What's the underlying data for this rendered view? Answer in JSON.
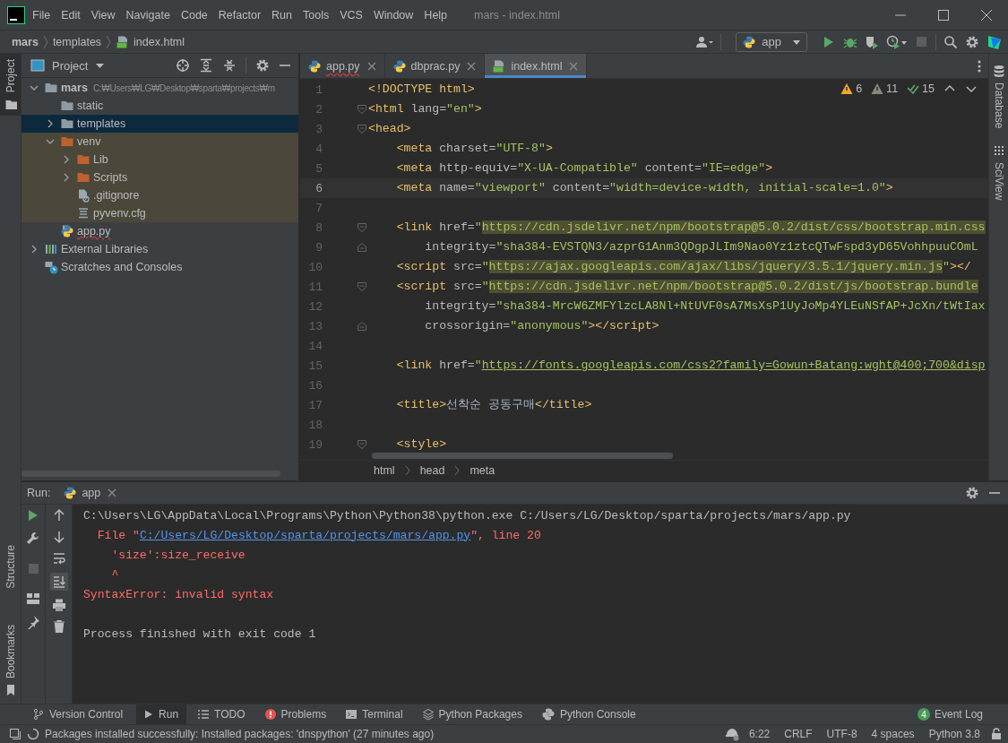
{
  "window": {
    "title": "mars - index.html",
    "menu": [
      "File",
      "Edit",
      "View",
      "Navigate",
      "Code",
      "Refactor",
      "Run",
      "Tools",
      "VCS",
      "Window",
      "Help"
    ]
  },
  "navigation": {
    "breadcrumb": [
      "mars",
      "templates",
      "index.html"
    ],
    "run_configuration": "app"
  },
  "left_stripe": [
    {
      "label": "Project",
      "selected": true
    },
    {
      "label": "Structure",
      "selected": false
    },
    {
      "label": "Bookmarks",
      "selected": false
    }
  ],
  "right_stripe": [
    {
      "label": "Database"
    },
    {
      "label": "SciView"
    }
  ],
  "project": {
    "title": "Project",
    "tree": [
      {
        "label": "mars",
        "path": "C:₩Users₩LG₩Desktop₩sparta₩projects₩m",
        "kind": "folder",
        "expanded": true,
        "selected": false,
        "children": [
          {
            "label": "static",
            "kind": "folder",
            "selected": false
          },
          {
            "label": "templates",
            "kind": "folder",
            "expanded": false,
            "selected": true
          },
          {
            "label": "venv",
            "kind": "excluded-folder",
            "expanded": true,
            "selected": false,
            "children": [
              {
                "label": "Lib",
                "kind": "excluded-folder",
                "expanded": false,
                "selected": false
              },
              {
                "label": "Scripts",
                "kind": "excluded-folder",
                "expanded": false,
                "selected": false
              },
              {
                "label": ".gitignore",
                "kind": "ignore-file",
                "selected": false
              },
              {
                "label": "pyvenv.cfg",
                "kind": "config-file",
                "selected": false
              }
            ]
          },
          {
            "label": "app.py",
            "kind": "python-file",
            "selected": false
          }
        ]
      },
      {
        "label": "External Libraries",
        "kind": "libraries",
        "expanded": false,
        "selected": false
      },
      {
        "label": "Scratches and Consoles",
        "kind": "scratches",
        "selected": false
      }
    ]
  },
  "editor": {
    "tabs": [
      {
        "label": "app.py",
        "kind": "python",
        "error": true,
        "selected": false
      },
      {
        "label": "dbprac.py",
        "kind": "python",
        "error": false,
        "selected": false
      },
      {
        "label": "index.html",
        "kind": "html",
        "error": false,
        "selected": true
      }
    ],
    "inspections": [
      {
        "kind": "warning",
        "count": "6"
      },
      {
        "kind": "weak-warning",
        "count": "11"
      },
      {
        "kind": "typo",
        "count": "15"
      }
    ],
    "lines": [
      {
        "number": "1",
        "kind": "plain",
        "current": false,
        "tokens": [
          {
            "kind": "tag",
            "text": "<!DOCTYPE html>"
          }
        ]
      },
      {
        "number": "2",
        "kind": "fold-start",
        "current": false,
        "tokens": [
          {
            "kind": "tag",
            "text": "<html"
          },
          {
            "kind": "attr",
            "text": " lang="
          },
          {
            "kind": "value",
            "text": "\"en\""
          },
          {
            "kind": "tag",
            "text": ">"
          }
        ]
      },
      {
        "number": "3",
        "kind": "fold-start",
        "current": false,
        "tokens": [
          {
            "kind": "tag",
            "text": "<head>"
          }
        ]
      },
      {
        "number": "4",
        "kind": "plain",
        "current": false,
        "tokens": [
          {
            "kind": "tag",
            "text": "    <meta"
          },
          {
            "kind": "attr",
            "text": " charset="
          },
          {
            "kind": "value",
            "text": "\"UTF-8\""
          },
          {
            "kind": "tag",
            "text": ">"
          }
        ]
      },
      {
        "number": "5",
        "kind": "plain",
        "current": false,
        "tokens": [
          {
            "kind": "tag",
            "text": "    <meta"
          },
          {
            "kind": "attr",
            "text": " http-equiv="
          },
          {
            "kind": "value",
            "text": "\"X-UA-Compatible\""
          },
          {
            "kind": "attr",
            "text": " content="
          },
          {
            "kind": "value",
            "text": "\"IE=edge\""
          },
          {
            "kind": "tag",
            "text": ">"
          }
        ]
      },
      {
        "number": "6",
        "kind": "plain",
        "current": true,
        "tokens": [
          {
            "kind": "tag",
            "text": "    <meta"
          },
          {
            "kind": "attr",
            "text": " name="
          },
          {
            "kind": "value",
            "text": "\"viewport\""
          },
          {
            "kind": "attr",
            "text": " content="
          },
          {
            "kind": "value",
            "text": "\"width=device-width, initial-scale=1.0\""
          },
          {
            "kind": "tag",
            "text": ">"
          }
        ]
      },
      {
        "number": "7",
        "kind": "plain",
        "current": false
      },
      {
        "number": "8",
        "kind": "fold-start",
        "current": false,
        "tokens": [
          {
            "kind": "tag",
            "text": "    <link"
          },
          {
            "kind": "attr",
            "text": " href="
          },
          {
            "kind": "value",
            "text": "\""
          },
          {
            "kind": "link",
            "text": "https://cdn.jsdelivr.net/npm/bootstrap@5.0.2/dist/css/bootstrap.min.css"
          }
        ]
      },
      {
        "number": "9",
        "kind": "fold-end",
        "current": false,
        "tokens": [
          {
            "kind": "attr",
            "text": "        integrity="
          },
          {
            "kind": "value",
            "text": "\"sha384-EVSTQN3/azprG1Anm3QDgpJLIm9Nao0Yz1ztcQTwFspd3yD65VohhpuuCOmL"
          }
        ]
      },
      {
        "number": "10",
        "kind": "plain",
        "current": false,
        "tokens": [
          {
            "kind": "tag",
            "text": "    <script"
          },
          {
            "kind": "attr",
            "text": " src="
          },
          {
            "kind": "value",
            "text": "\""
          },
          {
            "kind": "link",
            "text": "https://ajax.googleapis.com/ajax/libs/jquery/3.5.1/jquery.min.js"
          },
          {
            "kind": "value",
            "text": "\""
          },
          {
            "kind": "tag",
            "text": "></"
          }
        ]
      },
      {
        "number": "11",
        "kind": "fold-start",
        "current": false,
        "tokens": [
          {
            "kind": "tag",
            "text": "    <script"
          },
          {
            "kind": "attr",
            "text": " src="
          },
          {
            "kind": "value",
            "text": "\""
          },
          {
            "kind": "link",
            "text": "https://cdn.jsdelivr.net/npm/bootstrap@5.0.2/dist/js/bootstrap.bundle"
          }
        ]
      },
      {
        "number": "12",
        "kind": "plain",
        "current": false,
        "tokens": [
          {
            "kind": "attr",
            "text": "        integrity="
          },
          {
            "kind": "value",
            "text": "\"sha384-MrcW6ZMFYlzcLA8Nl+NtUVF0sA7MsXsP1UyJoMp4YLEuNSfAP+JcXn/tWtIax"
          }
        ]
      },
      {
        "number": "13",
        "kind": "fold-end",
        "current": false,
        "tokens": [
          {
            "kind": "attr",
            "text": "        crossorigin="
          },
          {
            "kind": "value",
            "text": "\"anonymous\""
          },
          {
            "kind": "tag",
            "text": "></script>"
          }
        ]
      },
      {
        "number": "14",
        "kind": "plain",
        "current": false
      },
      {
        "number": "15",
        "kind": "plain",
        "current": false,
        "tokens": [
          {
            "kind": "tag",
            "text": "    <link"
          },
          {
            "kind": "attr",
            "text": " href="
          },
          {
            "kind": "value",
            "text": "\""
          },
          {
            "kind": "href",
            "text": "https://fonts.googleapis.com/css2?family=Gowun+Batang:wght@400;700&disp"
          }
        ]
      },
      {
        "number": "16",
        "kind": "plain",
        "current": false
      },
      {
        "number": "17",
        "kind": "plain",
        "current": false,
        "tokens": [
          {
            "kind": "tag",
            "text": "    <title>"
          },
          {
            "kind": "text",
            "text": "선착순 공동구매"
          },
          {
            "kind": "tag",
            "text": "</title>"
          }
        ]
      },
      {
        "number": "18",
        "kind": "plain",
        "current": false
      },
      {
        "number": "19",
        "kind": "fold-start",
        "current": false,
        "tokens": [
          {
            "kind": "tag",
            "text": "    <style>"
          }
        ]
      }
    ],
    "breadcrumb": [
      "html",
      "head",
      "meta"
    ]
  },
  "run": {
    "title": "Run:",
    "tab": "app",
    "output": [
      {
        "separated": false,
        "tokens": [
          {
            "kind": "normal",
            "text": "C:\\Users\\LG\\AppData\\Local\\Programs\\Python\\Python38\\python.exe C:/Users/LG/Desktop/sparta/projects/mars/app.py"
          }
        ]
      },
      {
        "separated": false,
        "tokens": [
          {
            "kind": "error",
            "text": "  File \""
          },
          {
            "kind": "link",
            "text": "C:/Users/LG/Desktop/sparta/projects/mars/app.py"
          },
          {
            "kind": "error",
            "text": "\", line 20"
          }
        ]
      },
      {
        "separated": false,
        "tokens": [
          {
            "kind": "error",
            "text": "    'size':size_receive"
          }
        ]
      },
      {
        "separated": false,
        "tokens": [
          {
            "kind": "error",
            "text": "    ^"
          }
        ]
      },
      {
        "separated": false,
        "tokens": [
          {
            "kind": "error",
            "text": "SyntaxError: invalid syntax"
          }
        ]
      },
      {
        "separated": true,
        "tokens": [
          {
            "kind": "normal",
            "text": "Process finished with exit code 1"
          }
        ]
      }
    ]
  },
  "tool_windows": [
    {
      "label": "Version Control",
      "kind": "vcs",
      "selected": false
    },
    {
      "label": "Run",
      "kind": "run",
      "selected": true
    },
    {
      "label": "TODO",
      "kind": "todo",
      "selected": false
    },
    {
      "label": "Problems",
      "kind": "problems",
      "selected": false
    },
    {
      "label": "Terminal",
      "kind": "terminal",
      "selected": false
    },
    {
      "label": "Python Packages",
      "kind": "packages",
      "selected": false
    },
    {
      "label": "Python Console",
      "kind": "console",
      "selected": false
    }
  ],
  "event_log": {
    "label": "Event Log",
    "count": "4"
  },
  "status_bar": {
    "message": "Packages installed successfully: Installed packages: 'dnspython' (27 minutes ago)",
    "items": [
      "6:22",
      "CRLF",
      "UTF-8",
      "4 spaces",
      "Python 3.8"
    ]
  }
}
